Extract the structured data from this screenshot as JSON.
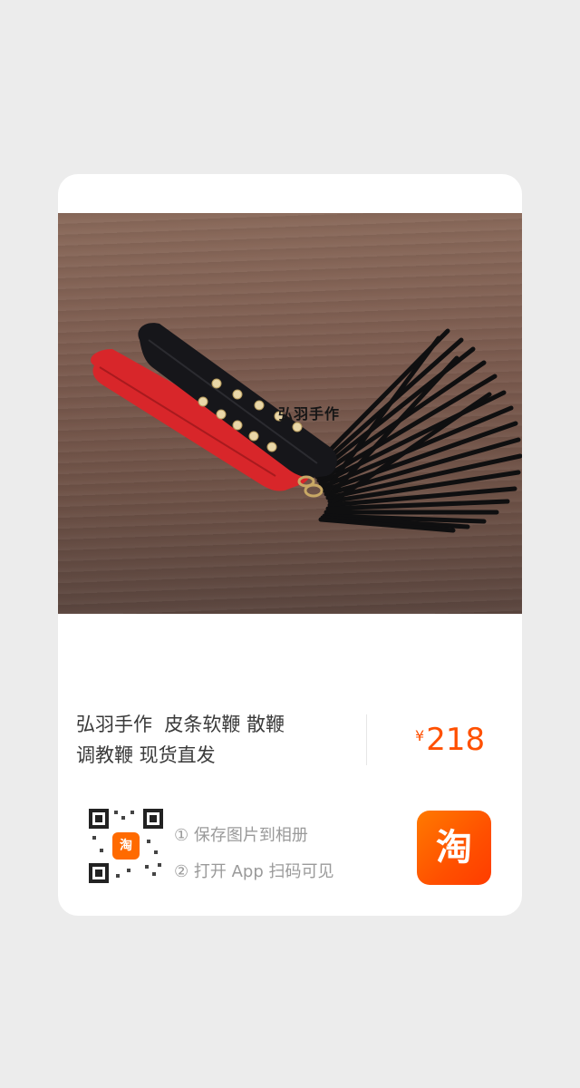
{
  "product": {
    "photo_watermark": "弘羽手作",
    "title_line1": "弘羽手作  皮条软鞭 散鞭",
    "title_line2": "调教鞭 现货直发",
    "currency": "¥",
    "price": "218"
  },
  "share": {
    "step1": "① 保存图片到相册",
    "step2": "② 打开 App 扫码可见",
    "app_logo_text": "淘",
    "qr_logo_text": "淘"
  },
  "colors": {
    "accent": "#ff5000",
    "page_bg": "#ececec",
    "card_bg": "#ffffff"
  },
  "icons": [
    "qr-code-icon",
    "taobao-logo-icon"
  ]
}
